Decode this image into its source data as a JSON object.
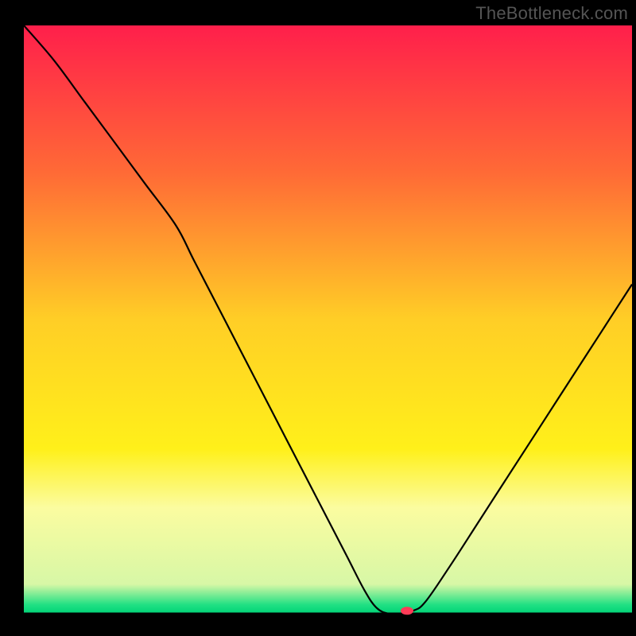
{
  "watermark": "TheBottleneck.com",
  "chart_data": {
    "type": "line",
    "title": "",
    "xlabel": "",
    "ylabel": "",
    "xlim": [
      0,
      100
    ],
    "ylim": [
      0,
      100
    ],
    "background_gradient": {
      "stops": [
        {
          "offset": 0.0,
          "color": "#ff1f4b"
        },
        {
          "offset": 0.25,
          "color": "#ff6a36"
        },
        {
          "offset": 0.5,
          "color": "#ffce26"
        },
        {
          "offset": 0.72,
          "color": "#fff01a"
        },
        {
          "offset": 0.82,
          "color": "#fbfca0"
        },
        {
          "offset": 0.95,
          "color": "#d7f7a6"
        },
        {
          "offset": 0.985,
          "color": "#1fe083"
        },
        {
          "offset": 1.0,
          "color": "#00d276"
        }
      ]
    },
    "series": [
      {
        "name": "bottleneck-curve",
        "color": "#000000",
        "x": [
          0,
          5,
          10,
          15,
          20,
          25,
          28,
          33,
          38,
          43,
          48,
          53,
          56,
          58,
          60,
          62,
          64,
          66,
          70,
          75,
          80,
          85,
          90,
          95,
          100
        ],
        "y": [
          100,
          94,
          87,
          80,
          73,
          66,
          60,
          50,
          40,
          30,
          20,
          10,
          4,
          1,
          0,
          0,
          0.5,
          2,
          8,
          16,
          24,
          32,
          40,
          48,
          56
        ]
      }
    ],
    "marker": {
      "name": "optimal-point",
      "x": 63,
      "y": 0.5,
      "color": "#ff3b57",
      "rx": 8,
      "ry": 5
    }
  }
}
